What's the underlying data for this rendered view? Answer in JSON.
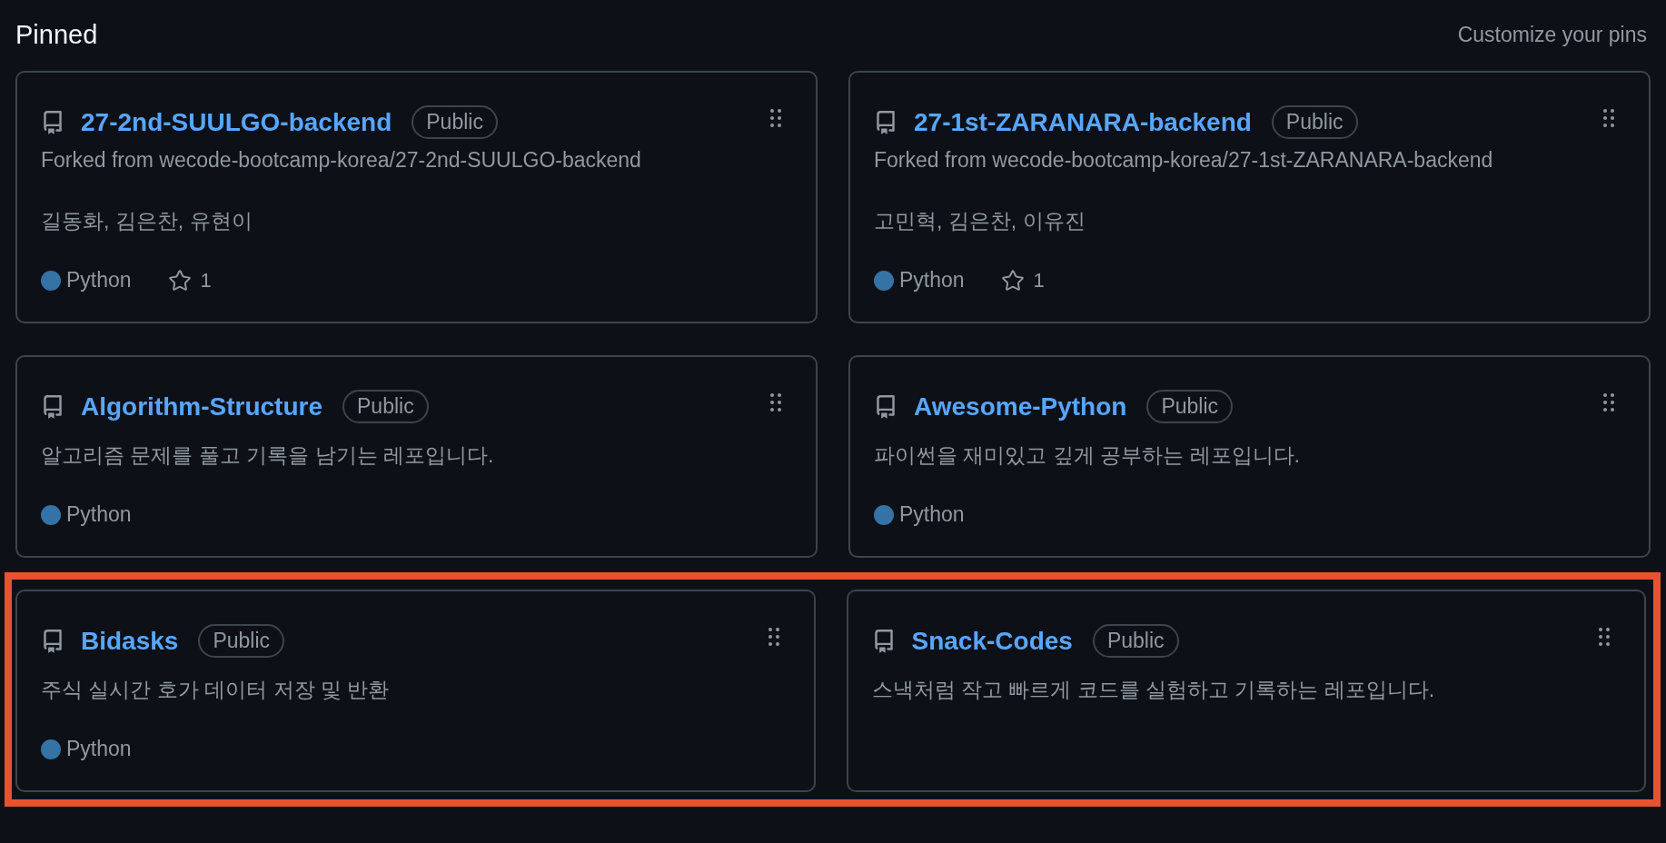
{
  "header": {
    "title": "Pinned",
    "action": "Customize your pins"
  },
  "rows": [
    {
      "highlighted": false,
      "repos": [
        {
          "name": "27-2nd-SUULGO-backend",
          "visibility": "Public",
          "forked_from": "Forked from wecode-bootcamp-korea/27-2nd-SUULGO-backend",
          "description": "길동화, 김은찬, 유현이",
          "language": "Python",
          "color": "#3572a5",
          "star_count": "1"
        },
        {
          "name": "27-1st-ZARANARA-backend",
          "visibility": "Public",
          "forked_from": "Forked from wecode-bootcamp-korea/27-1st-ZARANARA-backend",
          "description": "고민혁, 김은찬, 이유진",
          "language": "Python",
          "color": "#3572a5",
          "star_count": "1"
        }
      ]
    },
    {
      "highlighted": false,
      "repos": [
        {
          "name": "Algorithm-Structure",
          "visibility": "Public",
          "description": "알고리즘 문제를 풀고 기록을 남기는 레포입니다.",
          "language": "Python",
          "color": "#3572a5"
        },
        {
          "name": "Awesome-Python",
          "visibility": "Public",
          "description": "파이썬을 재미있고 깊게 공부하는 레포입니다.",
          "language": "Python",
          "color": "#3572a5"
        }
      ]
    },
    {
      "highlighted": true,
      "repos": [
        {
          "name": "Bidasks",
          "visibility": "Public",
          "description": "주식 실시간 호가 데이터 저장 및 반환",
          "language": "Python",
          "color": "#3572a5"
        },
        {
          "name": "Snack-Codes",
          "visibility": "Public",
          "description": "스낵처럼 작고 빠르게 코드를 실험하고 기록하는 레포입니다."
        }
      ]
    }
  ]
}
